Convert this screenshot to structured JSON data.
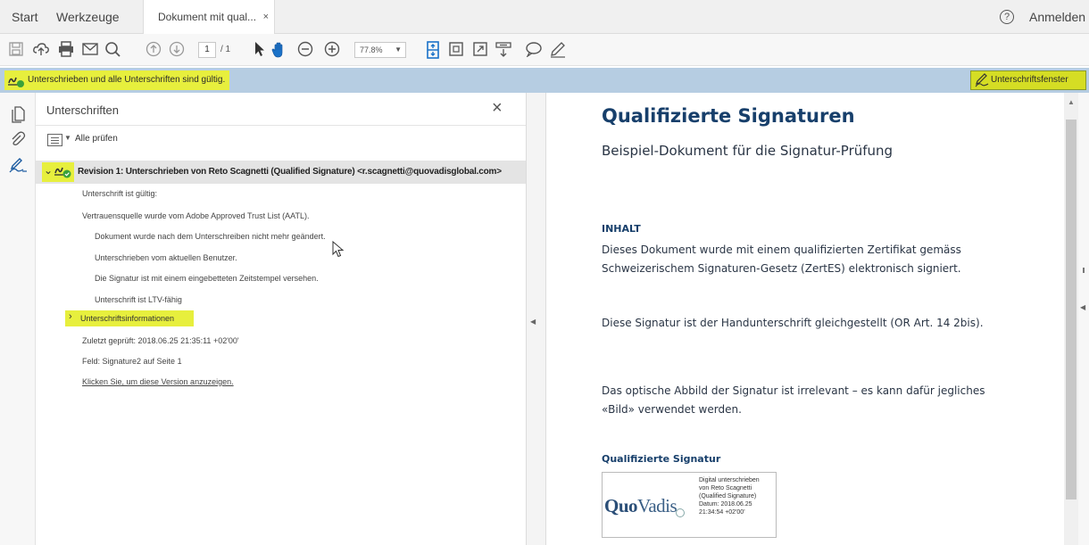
{
  "tabs": {
    "start": "Start",
    "tools": "Werkzeuge",
    "document": "Dokument mit qual...",
    "document_close": "×"
  },
  "header": {
    "login": "Anmelden",
    "help": "?"
  },
  "toolbar": {
    "page_current": "1",
    "page_total": "/ 1",
    "zoom": "77.8%"
  },
  "signature_bar": {
    "status": "Unterschrieben und alle Unterschriften sind gültig.",
    "signature_panel_button": "Unterschriftsfenster"
  },
  "panel": {
    "title": "Unterschriften",
    "close": "×",
    "check_all": "Alle prüfen",
    "revision": "Revision 1: Unterschrieben von Reto Scagnetti (Qualified Signature) <r.scagnetti@quovadisglobal.com>",
    "details": [
      "Unterschrift ist gültig:",
      "Vertrauensquelle wurde vom Adobe Approved Trust List (AATL).",
      "Dokument wurde nach dem Unterschreiben nicht mehr geändert.",
      "Unterschrieben vom aktuellen Benutzer.",
      "Die Signatur ist mit einem eingebetteten Zeitstempel versehen.",
      "Unterschrift ist LTV-fähig"
    ],
    "signature_info": "Unterschriftsinformationen",
    "last_checked": "Zuletzt geprüft: 2018.06.25 21:35:11 +02'00'",
    "field": "Feld: Signature2 auf Seite 1",
    "view_version_link": "Klicken Sie, um diese Version anzuzeigen."
  },
  "document": {
    "title": "Qualifizierte Signaturen",
    "subtitle": "Beispiel-Dokument für die Signatur-Prüfung",
    "section_heading": "INHALT",
    "paragraphs": [
      "Dieses Dokument wurde mit einem qualifizierten Zertifikat gemäss Schweizerischem Signaturen-Gesetz (ZertES) elektronisch signiert.",
      "Diese Signatur ist der Handunterschrift gleichgestellt (OR Art. 14 2bis).",
      "Das optische Abbild der Signatur ist irrelevant – es kann dafür jegliches «Bild» verwendet werden."
    ],
    "signature_heading": "Qualifizierte Signatur",
    "signature_logo_bold": "Quo",
    "signature_logo_rest": "Vadis",
    "signature_lines": [
      "Digital unterschrieben",
      "von Reto Scagnetti",
      "(Qualified Signature)",
      "Datum: 2018.06.25",
      "21:34:54 +02'00'"
    ]
  },
  "colors": {
    "highlight": "#e7ef3d",
    "signature_bar": "#b6cde2",
    "heading_blue": "#173f6b"
  },
  "icons": {
    "toolbar": [
      "save-icon",
      "upload-icon",
      "print-icon",
      "email-icon",
      "search-icon",
      "page-up-icon",
      "page-down-icon",
      "select-cursor-icon",
      "hand-icon",
      "zoom-out-icon",
      "zoom-in-icon",
      "fit-page-icon",
      "fit-width-icon",
      "fullscreen-icon",
      "read-mode-icon",
      "comment-icon",
      "pen-icon"
    ],
    "rail": [
      "pages-icon",
      "attachment-icon",
      "signature-icon"
    ]
  }
}
